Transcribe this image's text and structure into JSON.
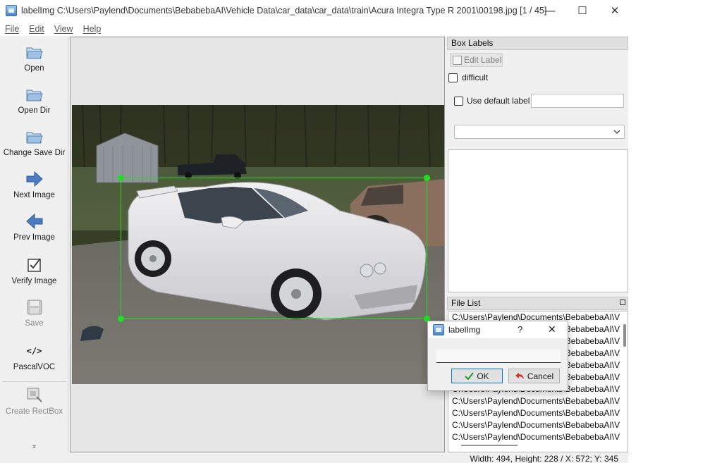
{
  "window": {
    "title": "labelImg C:\\Users\\Paylend\\Documents\\BebabebaAI\\Vehicle Data\\car_data\\car_data\\train\\Acura Integra Type R 2001\\00198.jpg [1 / 45]",
    "minimize": "—",
    "maximize": "☐",
    "close": "✕"
  },
  "menu": [
    "File",
    "Edit",
    "View",
    "Help"
  ],
  "toolbar": {
    "open": "Open",
    "open_dir": "Open Dir",
    "change_save_dir": "Change Save Dir",
    "next_image": "Next Image",
    "prev_image": "Prev Image",
    "verify_image": "Verify Image",
    "save": "Save",
    "format": "PascalVOC",
    "format_icon": "</>",
    "create_rectbox": "Create RectBox",
    "more": "»"
  },
  "box_labels": {
    "title": "Box Labels",
    "edit_label": "Edit Label",
    "difficult": "difficult",
    "use_default_label": "Use default label",
    "default_label_value": ""
  },
  "file_list": {
    "title": "File List",
    "items": [
      "C:\\Users\\Paylend\\Documents\\BebabebaAI\\V",
      "C:\\Users\\Paylend\\Documents\\BebabebaAI\\V",
      "C:\\Users\\Paylend\\Documents\\BebabebaAI\\V",
      "C:\\Users\\Paylend\\Documents\\BebabebaAI\\V",
      "C:\\Users\\Paylend\\Documents\\BebabebaAI\\V",
      "C:\\Users\\Paylend\\Documents\\BebabebaAI\\V",
      "C:\\Users\\Paylend\\Documents\\BebabebaAI\\V",
      "C:\\Users\\Paylend\\Documents\\BebabebaAI\\V",
      "C:\\Users\\Paylend\\Documents\\BebabebaAI\\V",
      "C:\\Users\\Paylend\\Documents\\BebabebaAI\\V",
      "C:\\Users\\Paylend\\Documents\\BebabebaAI\\V"
    ]
  },
  "dialog": {
    "title": "labelImg",
    "help": "?",
    "close": "✕",
    "input_value": "",
    "ok": "OK",
    "cancel": "Cancel"
  },
  "status": {
    "text": "Width: 494, Height: 228 / X: 572; Y: 345"
  },
  "colors": {
    "bbox": "#22dd22",
    "accent": "#0078d7",
    "arrow": "#3f6fb5"
  }
}
